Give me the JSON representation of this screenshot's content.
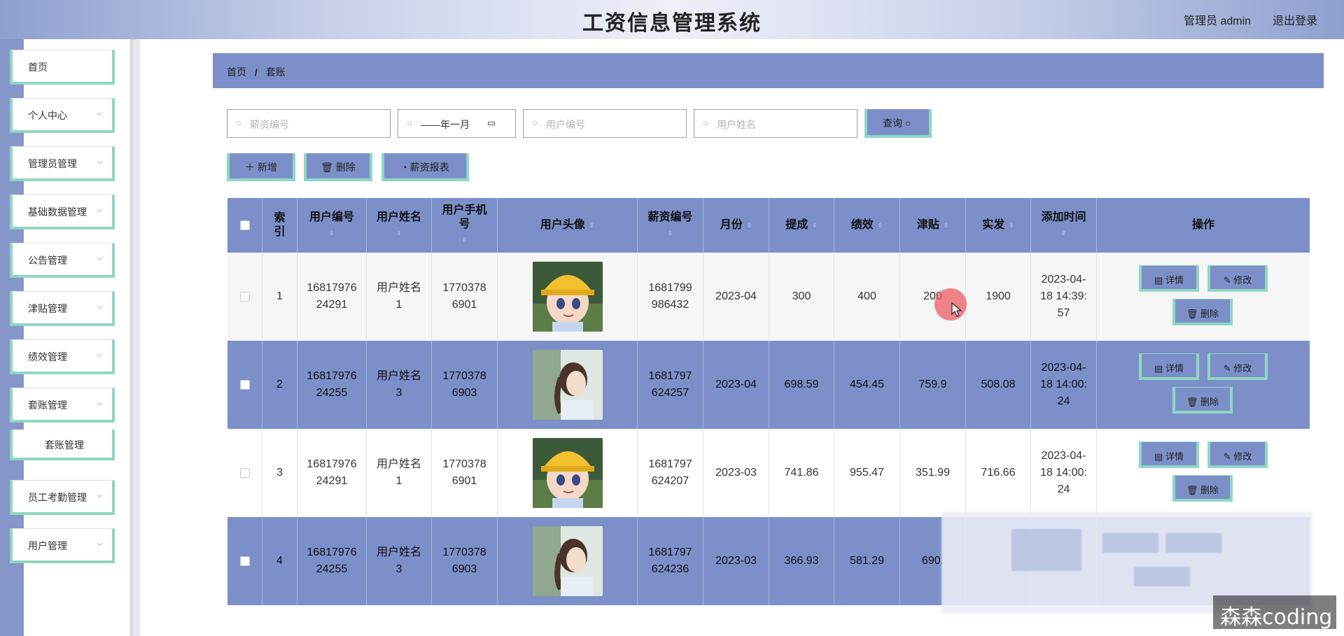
{
  "header": {
    "title": "工资信息管理系统",
    "user": "管理员 admin",
    "logout": "退出登录"
  },
  "sidebar": {
    "items": [
      {
        "label": "首页",
        "has_arrow": false
      },
      {
        "label": "个人中心",
        "has_arrow": true
      },
      {
        "label": "管理员管理",
        "has_arrow": true
      },
      {
        "label": "基础数据管理",
        "has_arrow": true
      },
      {
        "label": "公告管理",
        "has_arrow": true
      },
      {
        "label": "津贴管理",
        "has_arrow": true
      },
      {
        "label": "绩效管理",
        "has_arrow": true
      },
      {
        "label": "套账管理",
        "has_arrow": true
      },
      {
        "label": "员工考勤管理",
        "has_arrow": true
      },
      {
        "label": "用户管理",
        "has_arrow": true
      }
    ],
    "subitem": "套账管理",
    "arrow": "⌵"
  },
  "breadcrumb": {
    "home": "首页",
    "sep": "/",
    "current": "套账"
  },
  "search": {
    "salary_no_placeholder": "薪资编号",
    "month_value": "——年一月",
    "user_no_placeholder": "用户编号",
    "user_name_placeholder": "用户姓名",
    "query_label": "查询 ○"
  },
  "actions": {
    "add": "＋ 新增",
    "delete": "🗑 删除",
    "report": "◔ 薪资报表"
  },
  "table": {
    "headers": {
      "index": "索引",
      "user_no": "用户编号",
      "user_name": "用户姓名",
      "user_phone": "用户手机号",
      "avatar": "用户头像",
      "salary_no": "薪资编号",
      "month": "月份",
      "commission": "提成",
      "performance": "绩效",
      "allowance": "津贴",
      "actual": "实发",
      "added_time": "添加时间",
      "ops": "操作"
    },
    "sort_glyph": "⇳",
    "op_labels": {
      "detail": "详情",
      "edit": "修改",
      "delete": "删除"
    },
    "rows": [
      {
        "index": "1",
        "user_no_1": "16817976",
        "user_no_2": "24291",
        "name_1": "用户姓名",
        "name_2": "1",
        "phone_1": "1770378",
        "phone_2": "6901",
        "avatar": "girl-yellow-hat",
        "salary_1": "1681799",
        "salary_2": "986432",
        "month": "2023-04",
        "commission": "300",
        "performance": "400",
        "allowance": "200",
        "actual": "1900",
        "time_1": "2023-04-",
        "time_2": "18 14:39:",
        "time_3": "57"
      },
      {
        "index": "2",
        "user_no_1": "16817976",
        "user_no_2": "24255",
        "name_1": "用户姓名",
        "name_2": "3",
        "phone_1": "1770378",
        "phone_2": "6903",
        "avatar": "girl-ponytail",
        "salary_1": "1681797",
        "salary_2": "624257",
        "month": "2023-04",
        "commission": "698.59",
        "performance": "454.45",
        "allowance": "759.9",
        "actual": "508.08",
        "time_1": "2023-04-",
        "time_2": "18 14:00:",
        "time_3": "24"
      },
      {
        "index": "3",
        "user_no_1": "16817976",
        "user_no_2": "24291",
        "name_1": "用户姓名",
        "name_2": "1",
        "phone_1": "1770378",
        "phone_2": "6901",
        "avatar": "girl-yellow-hat",
        "salary_1": "1681797",
        "salary_2": "624207",
        "month": "2023-03",
        "commission": "741.86",
        "performance": "955.47",
        "allowance": "351.99",
        "actual": "716.66",
        "time_1": "2023-04-",
        "time_2": "18 14:00:",
        "time_3": "24"
      },
      {
        "index": "4",
        "user_no_1": "16817976",
        "user_no_2": "24255",
        "name_1": "用户姓名",
        "name_2": "3",
        "phone_1": "1770378",
        "phone_2": "6903",
        "avatar": "girl-ponytail",
        "salary_1": "1681797",
        "salary_2": "624236",
        "month": "2023-03",
        "commission": "366.93",
        "performance": "581.29",
        "allowance": "690.",
        "actual": "",
        "time_1": "",
        "time_2": "",
        "time_3": ""
      }
    ]
  },
  "watermark": "森森coding",
  "colors": {
    "accent": "#7c8fc9",
    "border_accent": "#8fd6c4",
    "row_alt": "#f6f6f6"
  }
}
